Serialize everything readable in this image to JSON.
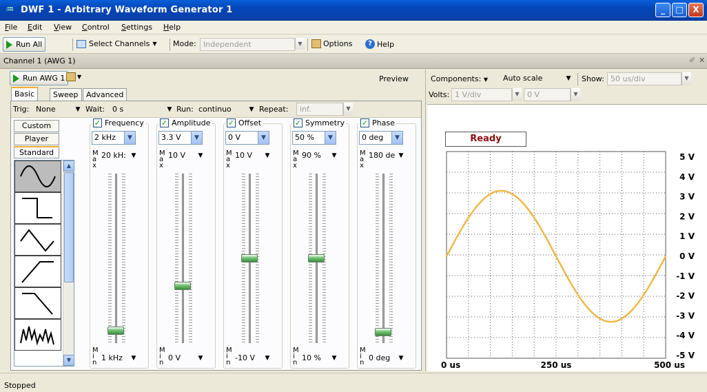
{
  "window": {
    "title": "DWF 1 - Arbitrary Waveform Generator 1",
    "app_icon": "dwf-icon",
    "minimize": "_",
    "maximize": "□",
    "close": "X"
  },
  "menu": [
    "File",
    "Edit",
    "View",
    "Control",
    "Settings",
    "Help"
  ],
  "toolbar": {
    "run_all": "Run All",
    "select_channels": "Select Channels",
    "mode_label": "Mode:",
    "mode_value": "Independent",
    "options": "Options",
    "help": "Help"
  },
  "channel": {
    "title": "Channel 1 (AWG 1)"
  },
  "left": {
    "run_awg": "Run AWG 1",
    "preview": "Preview",
    "tabs": [
      "Basic",
      "Sweep",
      "Advanced"
    ],
    "trig_label": "Trig:",
    "trig_value": "None",
    "wait_label": "Wait:",
    "wait_value": "0 s",
    "run_label": "Run:",
    "run_value": "continuo",
    "repeat_label": "Repeat:",
    "repeat_value": "inf.",
    "side_tabs": [
      "Custom",
      "Player",
      "Standard"
    ],
    "params": [
      {
        "name": "Frequency",
        "value": "2 kHz",
        "max": "20 kH:",
        "min": "1 kHz",
        "level": 0.05
      },
      {
        "name": "Amplitude",
        "value": "3.3 V",
        "max": "10 V",
        "min": "0 V",
        "level": 0.33
      },
      {
        "name": "Offset",
        "value": "0 V",
        "max": "10 V",
        "min": "-10 V",
        "level": 0.5
      },
      {
        "name": "Symmetry",
        "value": "50 %",
        "max": "90 %",
        "min": "10 %",
        "level": 0.5
      },
      {
        "name": "Phase",
        "value": "0 deg",
        "max": "180 de",
        "min": "0 deg",
        "level": 0.0
      }
    ],
    "max_letters": "M a x",
    "min_letters": "M i n"
  },
  "right": {
    "components_label": "Components:",
    "autoscale": "Auto scale",
    "show_label": "Show:",
    "show_value": "50 us/div",
    "volts_label": "Volts:",
    "volts_value": "1 V/div",
    "volts_offset": "0 V",
    "ready": "Ready",
    "y_ticks": [
      "5 V",
      "4 V",
      "3 V",
      "2 V",
      "1 V",
      "0 V",
      "-1 V",
      "-2 V",
      "-3 V",
      "-4 V",
      "-5 V"
    ],
    "x_ticks": [
      "0 us",
      "250 us",
      "500 us"
    ]
  },
  "waveform": {
    "amplitude_v": 3.3,
    "offset_v": 0,
    "frequency_hz": 2000,
    "color": "#f0b848"
  },
  "status": "Stopped"
}
